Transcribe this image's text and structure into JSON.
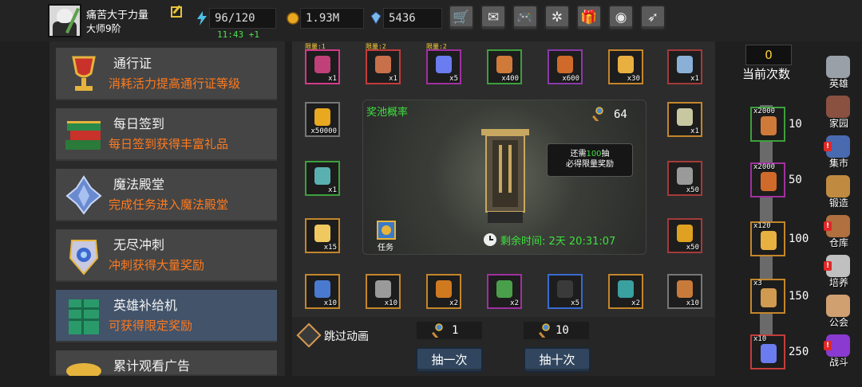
{
  "header": {
    "player_name": "痛苦大于力量",
    "player_rank": "大师9阶",
    "energy": "96/120",
    "energy_timer": "11:43 +1",
    "gold": "1.93M",
    "gems": "5436",
    "buttons": [
      "cart-icon",
      "mail-icon",
      "gamepad-icon",
      "gear-icon",
      "gift-icon",
      "color-wheel-icon",
      "feather-icon"
    ]
  },
  "left_menu": {
    "items": [
      {
        "title": "通行证",
        "desc": "消耗活力提高通行证等级",
        "icon": "chalice-icon"
      },
      {
        "title": "每日签到",
        "desc": "每日签到获得丰富礼品",
        "icon": "books-icon"
      },
      {
        "title": "魔法殿堂",
        "desc": "完成任务进入魔法殿堂",
        "icon": "crystal-icon"
      },
      {
        "title": "无尽冲刺",
        "desc": "冲刺获得大量奖励",
        "icon": "gem-shield-icon"
      },
      {
        "title": "英雄补给机",
        "desc": "可获得限定奖励",
        "icon": "supply-machine-icon"
      },
      {
        "title": "累计观看广告",
        "desc": "",
        "icon": "coin-stack-icon"
      }
    ]
  },
  "prize_grid": {
    "top_row": [
      {
        "limit": "限量:1",
        "count": "x1",
        "color": "#c0407a",
        "border": "#d23a8a"
      },
      {
        "limit": "限量:2",
        "count": "x1",
        "color": "#c8704a",
        "border": "#c43c3c"
      },
      {
        "limit": "限量:2",
        "count": "x5",
        "color": "#6a7cf0",
        "border": "#a030a0"
      },
      {
        "limit": "",
        "count": "x400",
        "color": "#d07a3a",
        "border": "#3ca03c"
      },
      {
        "limit": "",
        "count": "x600",
        "color": "#d06a2a",
        "border": "#8a3aa8"
      },
      {
        "limit": "",
        "count": "x30",
        "color": "#e8b040",
        "border": "#c4862a"
      },
      {
        "limit": "",
        "count": "x1",
        "color": "#8ab0d8",
        "border": "#a53a3a"
      }
    ],
    "left_col": [
      {
        "count": "x50000",
        "color": "#e8a820",
        "border": "#777"
      },
      {
        "count": "x1",
        "color": "#5ab0b0",
        "border": "#3ca03c"
      },
      {
        "count": "x15",
        "color": "#f0c860",
        "border": "#c4862a"
      }
    ],
    "right_col": [
      {
        "count": "x1",
        "color": "#c8c8a0",
        "border": "#c4862a"
      },
      {
        "count": "x50",
        "color": "#9a9a9a",
        "border": "#a53a3a"
      },
      {
        "count": "x50",
        "color": "#e0a020",
        "border": "#a53a3a"
      }
    ],
    "bottom_row": [
      {
        "count": "x10",
        "color": "#4a7ad0",
        "border": "#c4862a"
      },
      {
        "count": "x10",
        "color": "#9a9a9a",
        "border": "#c4862a"
      },
      {
        "count": "x2",
        "color": "#d07a20",
        "border": "#c4862a"
      },
      {
        "count": "x2",
        "color": "#4aa04a",
        "border": "#a030a0"
      },
      {
        "count": "x5",
        "color": "#3a3a3a",
        "border": "#3a6ad0"
      },
      {
        "count": "x2",
        "color": "#3aa0a0",
        "border": "#c4862a"
      },
      {
        "count": "x10",
        "color": "#c87a3a",
        "border": "#777"
      }
    ]
  },
  "pool": {
    "title": "奖池概率",
    "key_count": "64",
    "tooltip_prefix": "还需",
    "tooltip_num": "100",
    "tooltip_suffix": "抽",
    "tooltip_line2": "必得限量奖励",
    "remaining_label": "剩余时间: 2天 20:31:07",
    "task_label": "任务"
  },
  "draw": {
    "skip_label": "跳过动画",
    "single_cost": "1",
    "ten_cost": "10",
    "single_label": "抽一次",
    "ten_label": "抽十次"
  },
  "progress": {
    "count": "0",
    "count_label": "当前次数",
    "milestones": [
      {
        "amount": "x2000",
        "value": "10",
        "color": "#d07a3a",
        "border": "#3ca03c"
      },
      {
        "amount": "x2000",
        "value": "50",
        "color": "#d06a2a",
        "border": "#a030a0"
      },
      {
        "amount": "x120",
        "value": "100",
        "color": "#e8b040",
        "border": "#c4862a"
      },
      {
        "amount": "x3",
        "value": "150",
        "color": "#d09a50",
        "border": "#c4862a"
      },
      {
        "amount": "x10",
        "value": "250",
        "color": "#6a7cf0",
        "border": "#c43c3c"
      }
    ]
  },
  "right_nav": [
    {
      "label": "英雄",
      "badge": false,
      "color": "#9aa0a8"
    },
    {
      "label": "家园",
      "badge": false,
      "color": "#8a5040"
    },
    {
      "label": "集市",
      "badge": true,
      "color": "#4a6ab0"
    },
    {
      "label": "锻造",
      "badge": false,
      "color": "#c08a40"
    },
    {
      "label": "仓库",
      "badge": true,
      "color": "#b07040"
    },
    {
      "label": "培养",
      "badge": true,
      "color": "#c0c0c0"
    },
    {
      "label": "公会",
      "badge": false,
      "color": "#d0a070"
    },
    {
      "label": "战斗",
      "badge": true,
      "color": "#8a3ad0"
    }
  ]
}
